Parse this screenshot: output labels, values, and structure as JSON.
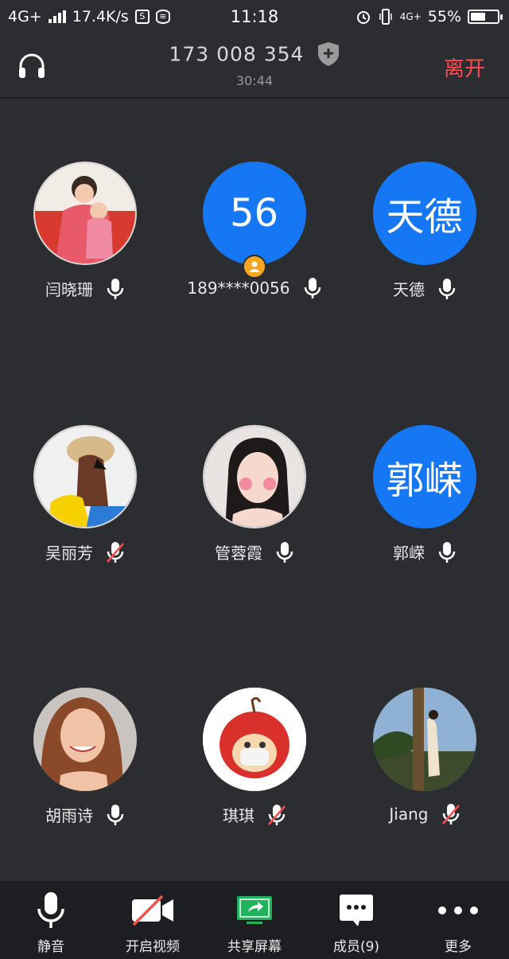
{
  "status_bar": {
    "network": "4G+",
    "speed": "17.4K/s",
    "time": "11:18",
    "network_right": "4G+",
    "battery": "55%",
    "battery_level": 0.55
  },
  "header": {
    "meeting_id": "173 008 354",
    "duration": "30:44",
    "leave_label": "离开"
  },
  "participants": [
    {
      "name": "闫晓珊",
      "avatar_type": "photo",
      "muted": false
    },
    {
      "name": "189****0056",
      "avatar_type": "text",
      "avatar_text": "56",
      "muted": false,
      "host": true
    },
    {
      "name": "天德",
      "avatar_type": "text",
      "avatar_text": "天德",
      "muted": false
    },
    {
      "name": "吴丽芳",
      "avatar_type": "photo",
      "muted": true
    },
    {
      "name": "管蓉霞",
      "avatar_type": "photo",
      "muted": false
    },
    {
      "name": "郭嵘",
      "avatar_type": "text",
      "avatar_text": "郭嵘",
      "muted": false
    },
    {
      "name": "胡雨诗",
      "avatar_type": "photo",
      "muted": false
    },
    {
      "name": "琪琪",
      "avatar_type": "photo",
      "muted": true
    },
    {
      "name": "Jiang",
      "avatar_type": "photo",
      "muted": true
    }
  ],
  "toolbar": {
    "mute_label": "静音",
    "video_label": "开启视频",
    "share_label": "共享屏幕",
    "members_label": "成员(9)",
    "more_label": "更多"
  },
  "colors": {
    "background": "#2b2d30",
    "accent_blue": "#1677f5",
    "leave_red": "#ff4d4f",
    "share_green": "#1fb35b",
    "host_badge": "#f5a623"
  }
}
